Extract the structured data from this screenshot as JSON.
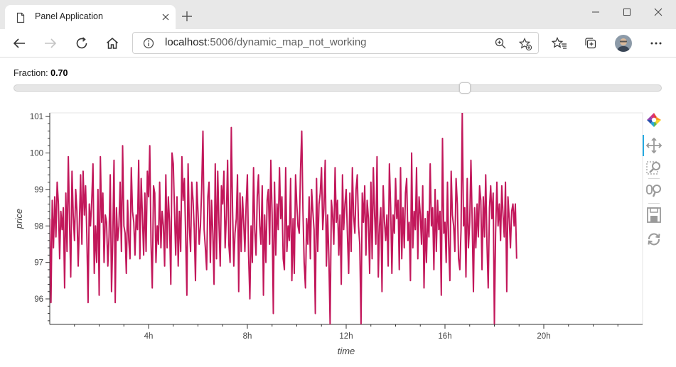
{
  "browser": {
    "tab_title": "Panel Application",
    "url_host": "localhost",
    "url_path": ":5006/dynamic_map_not_working"
  },
  "slider": {
    "label": "Fraction:",
    "value_text": "0.70",
    "value": 0.7,
    "min": 0,
    "max": 1
  },
  "chart_data": {
    "type": "line",
    "xlabel": "time",
    "ylabel": "price",
    "x_unit": "hours",
    "xlim": [
      0,
      24
    ],
    "ylim": [
      95.3,
      101.1
    ],
    "x_ticks": [
      {
        "value": 4,
        "label": "4h"
      },
      {
        "value": 8,
        "label": "8h"
      },
      {
        "value": 12,
        "label": "12h"
      },
      {
        "value": 16,
        "label": "16h"
      },
      {
        "value": 20,
        "label": "20h"
      }
    ],
    "y_ticks": [
      {
        "value": 96,
        "label": "96"
      },
      {
        "value": 97,
        "label": "97"
      },
      {
        "value": 98,
        "label": "98"
      },
      {
        "value": 99,
        "label": "99"
      },
      {
        "value": 100,
        "label": "100"
      },
      {
        "value": 101,
        "label": "101"
      }
    ],
    "series": [
      {
        "color": "#c2185b",
        "sample_interval_hours": 0.05,
        "values": [
          98.2,
          95.9,
          98.7,
          97.4,
          98.8,
          97.7,
          99.2,
          98.6,
          97.1,
          98.4,
          97.9,
          98.5,
          96.3,
          98.9,
          97.3,
          99.9,
          98.1,
          96.6,
          99.5,
          98.3,
          97.6,
          99.0,
          98.4,
          96.9,
          98.1,
          99.4,
          97.5,
          99.5,
          98.3,
          99.1,
          97.8,
          95.9,
          98.6,
          98.0,
          98.7,
          99.7,
          96.7,
          98.0,
          97.0,
          99.0,
          96.1,
          99.9,
          98.1,
          98.9,
          97.0,
          98.3,
          98.1,
          96.9,
          97.7,
          99.4,
          96.2,
          97.6,
          99.8,
          95.9,
          98.5,
          97.6,
          98.0,
          99.2,
          97.3,
          100.2,
          98.0,
          97.8,
          96.7,
          98.7,
          97.6,
          97.1,
          99.6,
          98.4,
          98.1,
          97.2,
          98.3,
          97.9,
          99.8,
          97.1,
          99.3,
          98.3,
          97.2,
          98.9,
          97.3,
          99.5,
          98.8,
          100.2,
          97.5,
          96.3,
          99.1,
          98.9,
          97.0,
          98.0,
          97.5,
          99.2,
          97.4,
          98.4,
          98.0,
          96.9,
          99.4,
          97.4,
          98.8,
          98.1,
          96.4,
          100.0,
          99.7,
          98.4,
          97.2,
          98.8,
          96.9,
          98.4,
          97.3,
          99.9,
          98.7,
          99.3,
          97.8,
          96.1,
          99.7,
          98.0,
          97.3,
          99.2,
          98.7,
          97.9,
          96.5,
          99.2,
          98.4,
          97.5,
          98.0,
          99.0,
          100.6,
          97.9,
          97.4,
          96.8,
          98.8,
          99.2,
          97.0,
          98.7,
          97.8,
          96.4,
          99.7,
          97.1,
          99.5,
          98.1,
          96.9,
          99.1,
          98.6,
          99.5,
          97.4,
          98.3,
          99.8,
          97.5,
          97.0,
          100.7,
          98.4,
          96.9,
          97.8,
          98.2,
          99.4,
          96.2,
          98.9,
          97.3,
          98.8,
          98.1,
          97.3,
          98.6,
          99.4,
          97.2,
          96.0,
          98.0,
          97.0,
          99.6,
          97.9,
          97.2,
          98.8,
          99.4,
          98.0,
          97.5,
          99.1,
          96.1,
          98.3,
          97.0,
          98.7,
          99.0,
          97.5,
          99.8,
          98.3,
          95.6,
          99.2,
          97.2,
          98.6,
          97.9,
          99.6,
          98.2,
          98.8,
          97.1,
          96.8,
          99.6,
          97.3,
          98.0,
          97.6,
          99.3,
          96.5,
          98.2,
          96.7,
          99.4,
          98.6,
          98.0,
          97.8,
          99.5,
          100.6,
          98.4,
          97.0,
          96.3,
          98.2,
          97.5,
          98.8,
          97.1,
          99.0,
          98.4,
          97.9,
          95.6,
          99.3,
          97.3,
          98.6,
          98.9,
          99.6,
          97.9,
          98.5,
          99.8,
          96.9,
          98.3,
          97.1,
          95.3,
          98.7,
          98.3,
          97.5,
          99.6,
          98.1,
          98.7,
          97.2,
          98.3,
          96.4,
          99.4,
          97.9,
          98.6,
          99.0,
          97.8,
          96.7,
          98.9,
          97.3,
          99.6,
          98.3,
          97.8,
          99.0,
          99.4,
          98.0,
          97.5,
          95.3,
          98.9,
          98.1,
          99.1,
          97.2,
          98.7,
          98.2,
          96.7,
          99.2,
          97.1,
          99.6,
          98.3,
          97.5,
          99.9,
          96.6,
          98.0,
          98.5,
          96.2,
          99.1,
          98.1,
          97.6,
          98.3,
          96.9,
          99.7,
          98.5,
          96.7,
          98.3,
          97.8,
          99.3,
          98.2,
          98.7,
          96.8,
          99.6,
          97.1,
          98.5,
          97.4,
          98.9,
          99.3,
          97.6,
          98.1,
          96.5,
          100.0,
          97.4,
          98.4,
          97.9,
          99.6,
          97.1,
          98.8,
          98.3,
          97.5,
          99.1,
          96.3,
          98.2,
          97.0,
          98.4,
          97.7,
          99.7,
          98.0,
          98.5,
          96.8,
          99.0,
          97.3,
          98.7,
          97.9,
          98.4,
          96.1,
          100.4,
          97.8,
          98.1,
          97.0,
          99.2,
          97.5,
          96.5,
          99.5,
          98.3,
          98.0,
          97.3,
          99.3,
          98.6,
          97.1,
          96.8,
          97.9,
          101.1,
          98.0,
          98.5,
          96.6,
          99.3,
          97.4,
          98.1,
          99.8,
          98.2,
          96.2,
          98.5,
          97.4,
          98.6,
          97.7,
          99.1,
          98.7,
          96.8,
          98.8,
          97.7,
          99.4,
          97.5,
          96.3,
          98.5,
          99.1,
          98.2,
          98.9,
          95.3,
          97.8,
          99.2,
          98.0,
          98.6,
          97.6,
          99.1,
          98.3,
          97.7,
          99.2,
          96.2,
          98.8,
          98.2,
          97.4,
          98.4,
          98.6,
          98.0,
          98.6,
          97.1
        ]
      }
    ]
  },
  "plot_tools": [
    {
      "name": "bokeh-logo-icon"
    },
    {
      "name": "pan-tool-icon",
      "active": true
    },
    {
      "name": "box-zoom-tool-icon"
    },
    {
      "name": "wheel-zoom-tool-icon"
    },
    {
      "name": "save-tool-icon"
    },
    {
      "name": "reset-tool-icon"
    }
  ]
}
